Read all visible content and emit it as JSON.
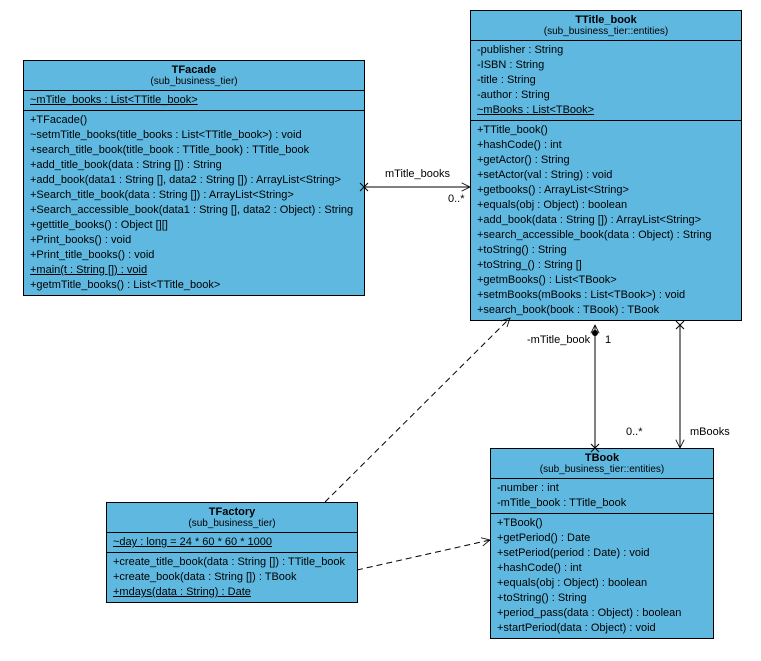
{
  "classes": {
    "tfacade": {
      "name": "TFacade",
      "stereotype": "(sub_business_tier)",
      "attrs": [
        "~mTitle_books : List<TTitle_book>"
      ],
      "ops": [
        "+TFacade()",
        "~setmTitle_books(title_books : List<TTitle_book>) : void",
        "+search_title_book(title_book : TTitle_book) : TTitle_book",
        "+add_title_book(data : String []) : String",
        "+add_book(data1 : String [], data2 : String []) : ArrayList<String>",
        "+Search_title_book(data : String []) : ArrayList<String>",
        "+Search_accessible_book(data1 : String [], data2 : Object) : String",
        "+gettitle_books() : Object [][]",
        "+Print_books() : void",
        "+Print_title_books() : void",
        "+main(t : String []) : void",
        "+getmTitle_books() : List<TTitle_book>"
      ]
    },
    "ttitle_book": {
      "name": "TTitle_book",
      "stereotype": "(sub_business_tier::entities)",
      "attrs": [
        "-publisher : String",
        "-ISBN : String",
        "-title : String",
        "-author : String",
        "~mBooks : List<TBook>"
      ],
      "ops": [
        "+TTitle_book()",
        "+hashCode() : int",
        "+getActor() : String",
        "+setActor(val : String) : void",
        "+getbooks() : ArrayList<String>",
        "+equals(obj : Object) : boolean",
        "+add_book(data : String []) : ArrayList<String>",
        "+search_accessible_book(data : Object) : String",
        "+toString() : String",
        "+toString_() : String []",
        "+getmBooks() : List<TBook>",
        "+setmBooks(mBooks : List<TBook>) : void",
        "+search_book(book : TBook) : TBook"
      ]
    },
    "tfactory": {
      "name": "TFactory",
      "stereotype": "(sub_business_tier)",
      "attrs": [
        "~day : long = 24 * 60 * 60 * 1000"
      ],
      "ops": [
        "+create_title_book(data : String []) : TTitle_book",
        "+create_book(data : String []) : TBook",
        "+mdays(data : String) : Date"
      ]
    },
    "tbook": {
      "name": "TBook",
      "stereotype": "(sub_business_tier::entities)",
      "attrs": [
        "-number : int",
        "-mTitle_book : TTitle_book"
      ],
      "ops": [
        "+TBook()",
        "+getPeriod() : Date",
        "+setPeriod(period : Date) : void",
        "+hashCode() : int",
        "+equals(obj : Object) : boolean",
        "+toString() : String",
        "+period_pass(data : Object) : boolean",
        "+startPeriod(data : Object) : void"
      ]
    }
  },
  "labels": {
    "mtitle_books": "mTitle_books",
    "mtitle_books_mult": "0..*",
    "mtitle_book": "-mTitle_book",
    "mtitle_book_mult": "1",
    "mbooks": "mBooks",
    "mbooks_mult": "0..*"
  }
}
